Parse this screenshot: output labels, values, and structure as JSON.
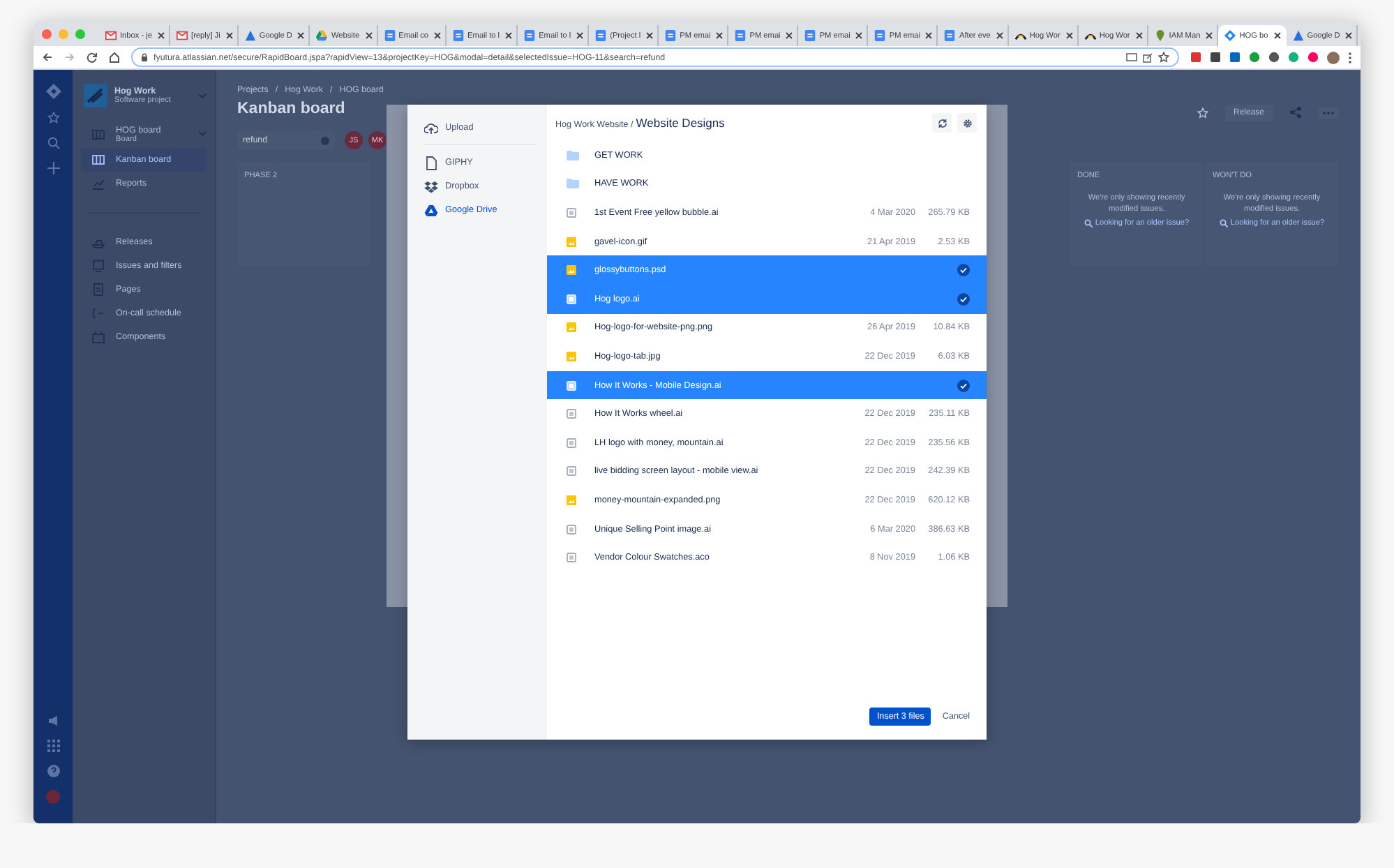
{
  "browser": {
    "tabs": [
      {
        "title": "Inbox - je",
        "kind": "mail",
        "selected": false
      },
      {
        "title": "[reply] Ji",
        "kind": "mail",
        "selected": false
      },
      {
        "title": "Google D",
        "kind": "triangle",
        "selected": false
      },
      {
        "title": "Website",
        "kind": "drive",
        "selected": false
      },
      {
        "title": "Email co",
        "kind": "doc",
        "selected": false
      },
      {
        "title": "Email to l",
        "kind": "doc",
        "selected": false
      },
      {
        "title": "Email to l",
        "kind": "doc",
        "selected": false
      },
      {
        "title": "(Project l",
        "kind": "doc",
        "selected": false
      },
      {
        "title": "PM emai",
        "kind": "doc",
        "selected": false
      },
      {
        "title": "PM emai",
        "kind": "doc",
        "selected": false
      },
      {
        "title": "PM emai",
        "kind": "doc",
        "selected": false
      },
      {
        "title": "PM emai",
        "kind": "doc",
        "selected": false
      },
      {
        "title": "After eve",
        "kind": "doc",
        "selected": false
      },
      {
        "title": "Hog Wor",
        "kind": "arc",
        "selected": false
      },
      {
        "title": "Hog Wor",
        "kind": "arc",
        "selected": false
      },
      {
        "title": "IAM Man",
        "kind": "pin",
        "selected": false
      },
      {
        "title": "HOG bo",
        "kind": "diamond",
        "selected": true
      },
      {
        "title": "Google D",
        "kind": "triangle",
        "selected": false
      }
    ],
    "address": "fyutura.atlassian.net/secure/RapidBoard.jspa?rapidView=13&projectKey=HOG&modal=detail&selectedIssue=HOG-11&search=refund"
  },
  "sidebar": {
    "project_name": "Hog Work",
    "project_type": "Software project",
    "board_name": "HOG board",
    "board_type": "Board",
    "board_items": [
      {
        "label": "Kanban board",
        "kind": "board",
        "selected": true
      },
      {
        "label": "Reports",
        "kind": "reports",
        "selected": false
      }
    ],
    "project_items": [
      {
        "label": "Releases",
        "kind": "releases"
      },
      {
        "label": "Issues and filters",
        "kind": "issues"
      },
      {
        "label": "Pages",
        "kind": "pages"
      },
      {
        "label": "On-call schedule",
        "kind": "oncall"
      },
      {
        "label": "Components",
        "kind": "components"
      }
    ]
  },
  "board": {
    "breadcrumbs": [
      "Projects",
      "Hog Work",
      "HOG board"
    ],
    "breadcrumb_separator": "/",
    "title": "Kanban board",
    "search": "refund",
    "avatars": [
      {
        "initials": "JS"
      },
      {
        "initials": "MK"
      }
    ],
    "release_button": "Release",
    "columns": [
      {
        "title": "PHASE 2"
      },
      {
        "title": "DONE",
        "note": "We're only showing recently modified issues.",
        "link": "Looking for an older issue?"
      },
      {
        "title": "WON'T DO",
        "note": "We're only showing recently modified issues.",
        "link": "Looking for an older issue?"
      }
    ]
  },
  "picker": {
    "sources": [
      {
        "label": "Upload",
        "kind": "upload",
        "selected": false
      },
      {
        "label": "GIPHY",
        "kind": "giphy",
        "selected": false
      },
      {
        "label": "Dropbox",
        "kind": "dropbox",
        "selected": false
      },
      {
        "label": "Google Drive",
        "kind": "drive",
        "selected": true
      }
    ],
    "path_parent": "Hog Work Website /",
    "path_current": "Website Designs",
    "files": [
      {
        "name": "GET WORK",
        "kind": "folder",
        "selected": false
      },
      {
        "name": "HAVE WORK",
        "kind": "folder",
        "selected": false
      },
      {
        "name": "1st Event Free yellow bubble.ai",
        "kind": "file",
        "date": "4 Mar 2020",
        "size": "265.79 KB",
        "selected": false
      },
      {
        "name": "gavel-icon.gif",
        "kind": "image",
        "date": "21 Apr 2019",
        "size": "2.53 KB",
        "selected": false
      },
      {
        "name": "glossybuttons.psd",
        "kind": "image",
        "selected": true
      },
      {
        "name": "Hog logo.ai",
        "kind": "file",
        "selected": true
      },
      {
        "name": "Hog-logo-for-website-png.png",
        "kind": "image",
        "date": "26 Apr 2019",
        "size": "10.84 KB",
        "selected": false
      },
      {
        "name": "Hog-logo-tab.jpg",
        "kind": "image",
        "date": "22 Dec 2019",
        "size": "6.03 KB",
        "selected": false
      },
      {
        "name": "How It Works - Mobile Design.ai",
        "kind": "file",
        "selected": true
      },
      {
        "name": "How It Works wheel.ai",
        "kind": "file",
        "date": "22 Dec 2019",
        "size": "235.11 KB",
        "selected": false
      },
      {
        "name": "LH logo with money, mountain.ai",
        "kind": "file",
        "date": "22 Dec 2019",
        "size": "235.56 KB",
        "selected": false
      },
      {
        "name": "live bidding screen layout - mobile view.ai",
        "kind": "file",
        "date": "22 Dec 2019",
        "size": "242.39 KB",
        "selected": false
      },
      {
        "name": "money-mountain-expanded.png",
        "kind": "image",
        "date": "22 Dec 2019",
        "size": "620.12 KB",
        "selected": false
      },
      {
        "name": "Unique Selling Point image.ai",
        "kind": "file",
        "date": "6 Mar 2020",
        "size": "386.63 KB",
        "selected": false
      },
      {
        "name": "Vendor Colour Swatches.aco",
        "kind": "file",
        "date": "8 Nov 2019",
        "size": "1.06 KB",
        "selected": false
      }
    ],
    "insert_button": "Insert 3 files",
    "cancel_button": "Cancel"
  }
}
